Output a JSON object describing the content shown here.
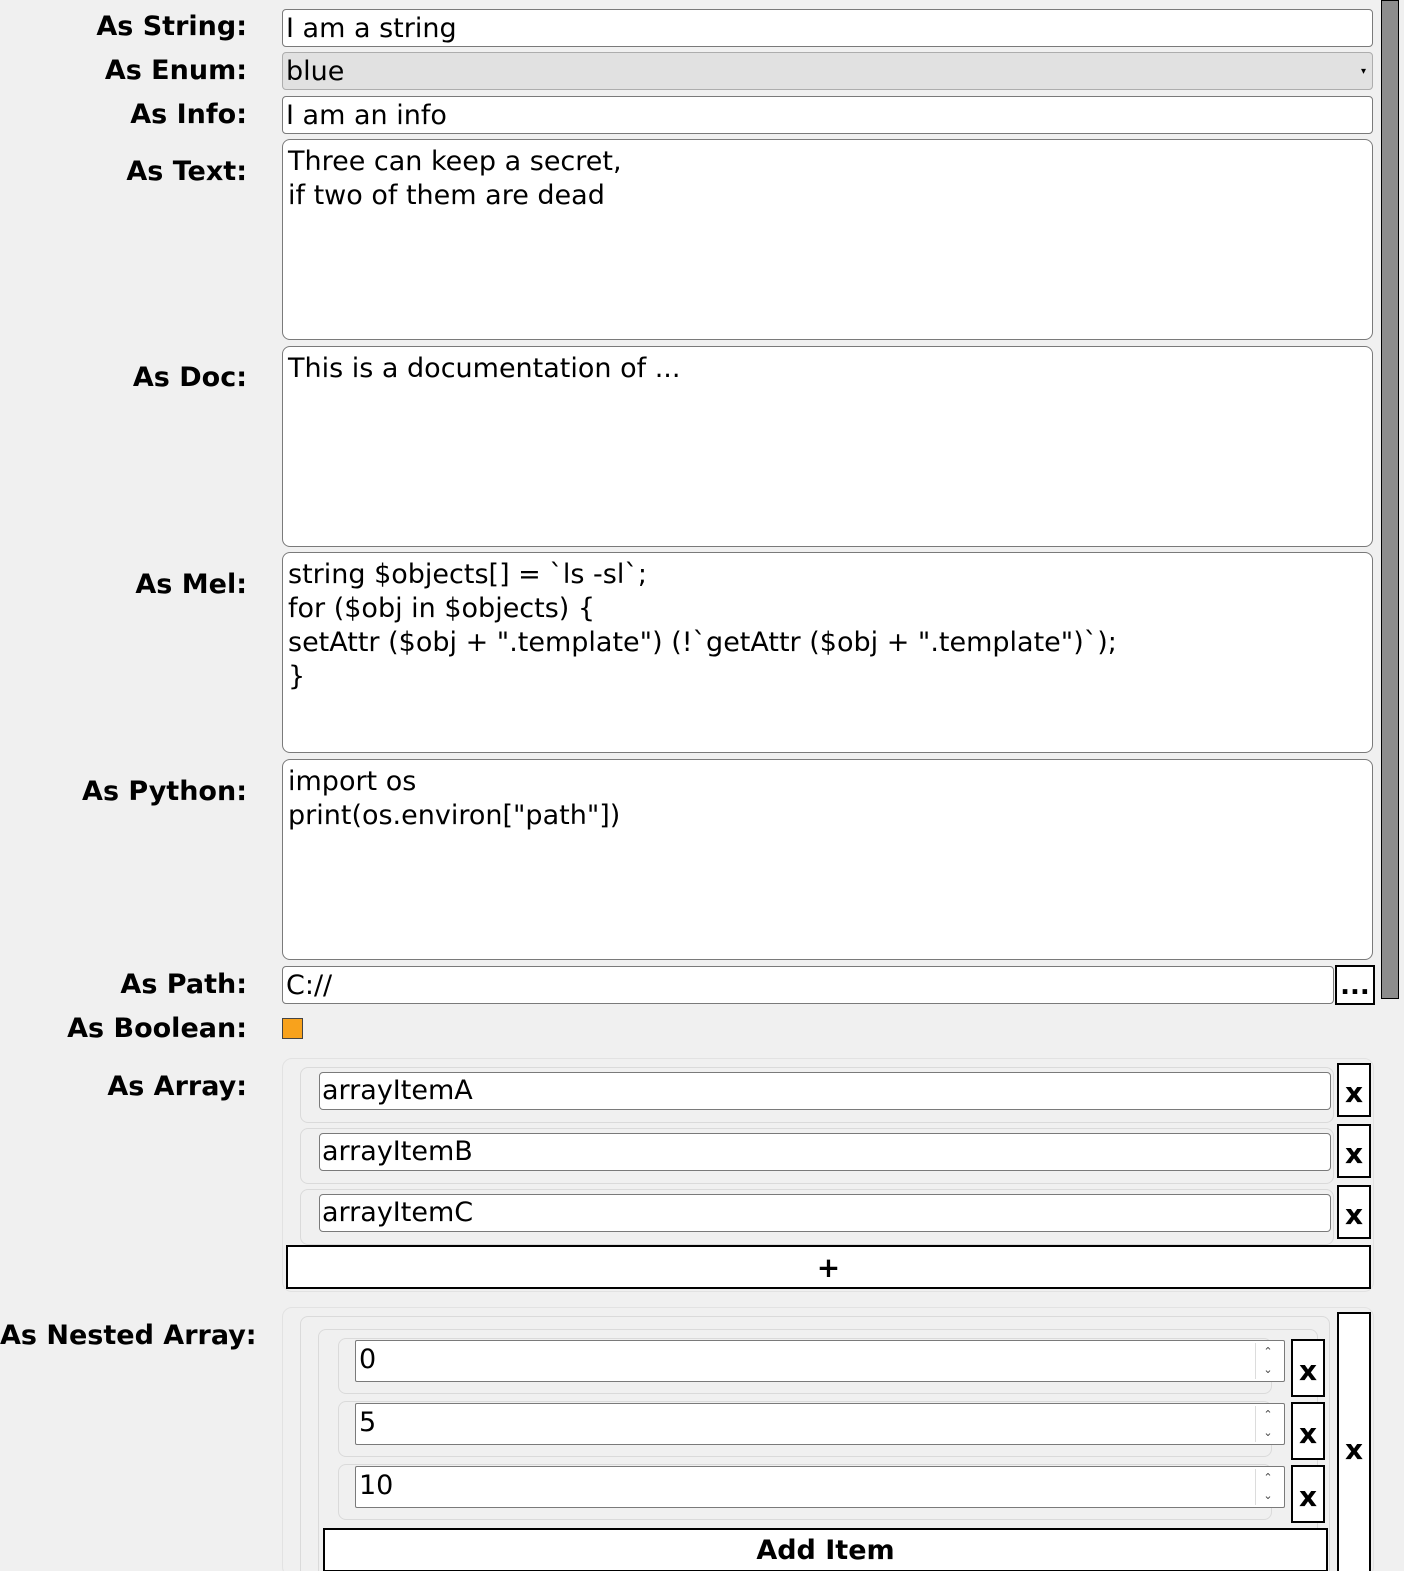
{
  "labels": {
    "string": "As String:",
    "enum": "As Enum:",
    "info": "As Info:",
    "text": "As Text:",
    "doc": "As Doc:",
    "mel": "As Mel:",
    "python": "As Python:",
    "path": "As Path:",
    "boolean": "As Boolean:",
    "array": "As Array:",
    "nested_array": "As Nested Array:"
  },
  "values": {
    "string": "I am a string",
    "enum": "blue",
    "info": "I am an info",
    "text": "Three can keep a secret,\nif two of them are dead",
    "doc": "This is a documentation of ...",
    "mel": "string $objects[] = `ls -sl`;\nfor ($obj in $objects) {\nsetAttr ($obj + \".template\") (!`getAttr ($obj + \".template\")`);\n}",
    "python": "import os\nprint(os.environ[\"path\"])",
    "path": "C://",
    "boolean": true
  },
  "buttons": {
    "browse": "...",
    "remove": "x",
    "add": "+",
    "add_item": "Add Item"
  },
  "array_items": [
    "arrayItemA",
    "arrayItemB",
    "arrayItemC"
  ],
  "nested_items": [
    "0",
    "5",
    "10"
  ],
  "icons": {
    "enum_dropdown": "dropdown-arrow-icon",
    "spin_up": "chevron-up-icon",
    "spin_down": "chevron-down-icon"
  },
  "colors": {
    "checkbox": "#f8a21c",
    "background": "#f0f0f0"
  }
}
